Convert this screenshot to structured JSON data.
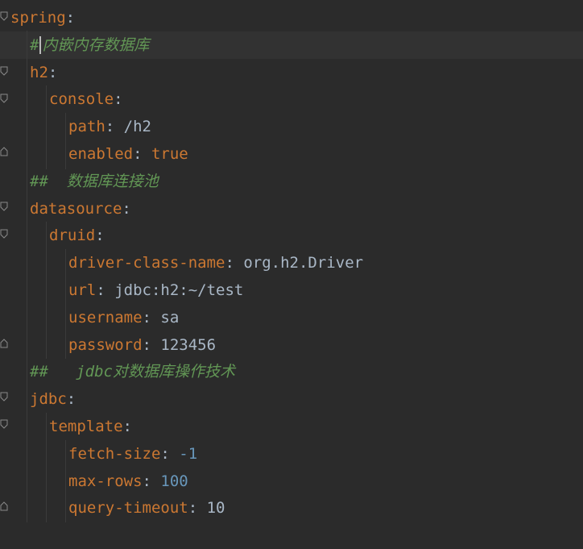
{
  "lines": [
    {
      "indent": 0,
      "key": "spring",
      "colon": ":",
      "value": "",
      "type": ""
    },
    {
      "indent": 1,
      "comment": "#内嵌内存数据库",
      "caret_after": "#",
      "current": true
    },
    {
      "indent": 1,
      "key": "h2",
      "colon": ":",
      "value": "",
      "type": ""
    },
    {
      "indent": 2,
      "key": "console",
      "colon": ":",
      "value": "",
      "type": ""
    },
    {
      "indent": 3,
      "key": "path",
      "colon": ":",
      "value": " /h2",
      "type": "val"
    },
    {
      "indent": 3,
      "key": "enabled",
      "colon": ":",
      "value": " true",
      "type": "bool"
    },
    {
      "indent": 1,
      "comment": "##  数据库连接池"
    },
    {
      "indent": 1,
      "key": "datasource",
      "colon": ":",
      "value": "",
      "type": ""
    },
    {
      "indent": 2,
      "key": "druid",
      "colon": ":",
      "value": "",
      "type": ""
    },
    {
      "indent": 3,
      "key": "driver-class-name",
      "colon": ":",
      "value": " org.h2.Driver",
      "type": "val"
    },
    {
      "indent": 3,
      "key": "url",
      "colon": ":",
      "value": " jdbc:h2:~/test",
      "type": "val"
    },
    {
      "indent": 3,
      "key": "username",
      "colon": ":",
      "value": " sa",
      "type": "val"
    },
    {
      "indent": 3,
      "key": "password",
      "colon": ":",
      "value": " 123456",
      "type": "val"
    },
    {
      "indent": 1,
      "comment": "##   jdbc对数据库操作技术"
    },
    {
      "indent": 1,
      "key": "jdbc",
      "colon": ":",
      "value": "",
      "type": ""
    },
    {
      "indent": 2,
      "key": "template",
      "colon": ":",
      "value": "",
      "type": ""
    },
    {
      "indent": 3,
      "key": "fetch-size",
      "colon": ":",
      "value": " -1",
      "type": "num"
    },
    {
      "indent": 3,
      "key": "max-rows",
      "colon": ":",
      "value": " 100",
      "type": "num"
    },
    {
      "indent": 3,
      "key": "query-timeout",
      "colon": ":",
      "value": " 10",
      "type": "val"
    }
  ]
}
